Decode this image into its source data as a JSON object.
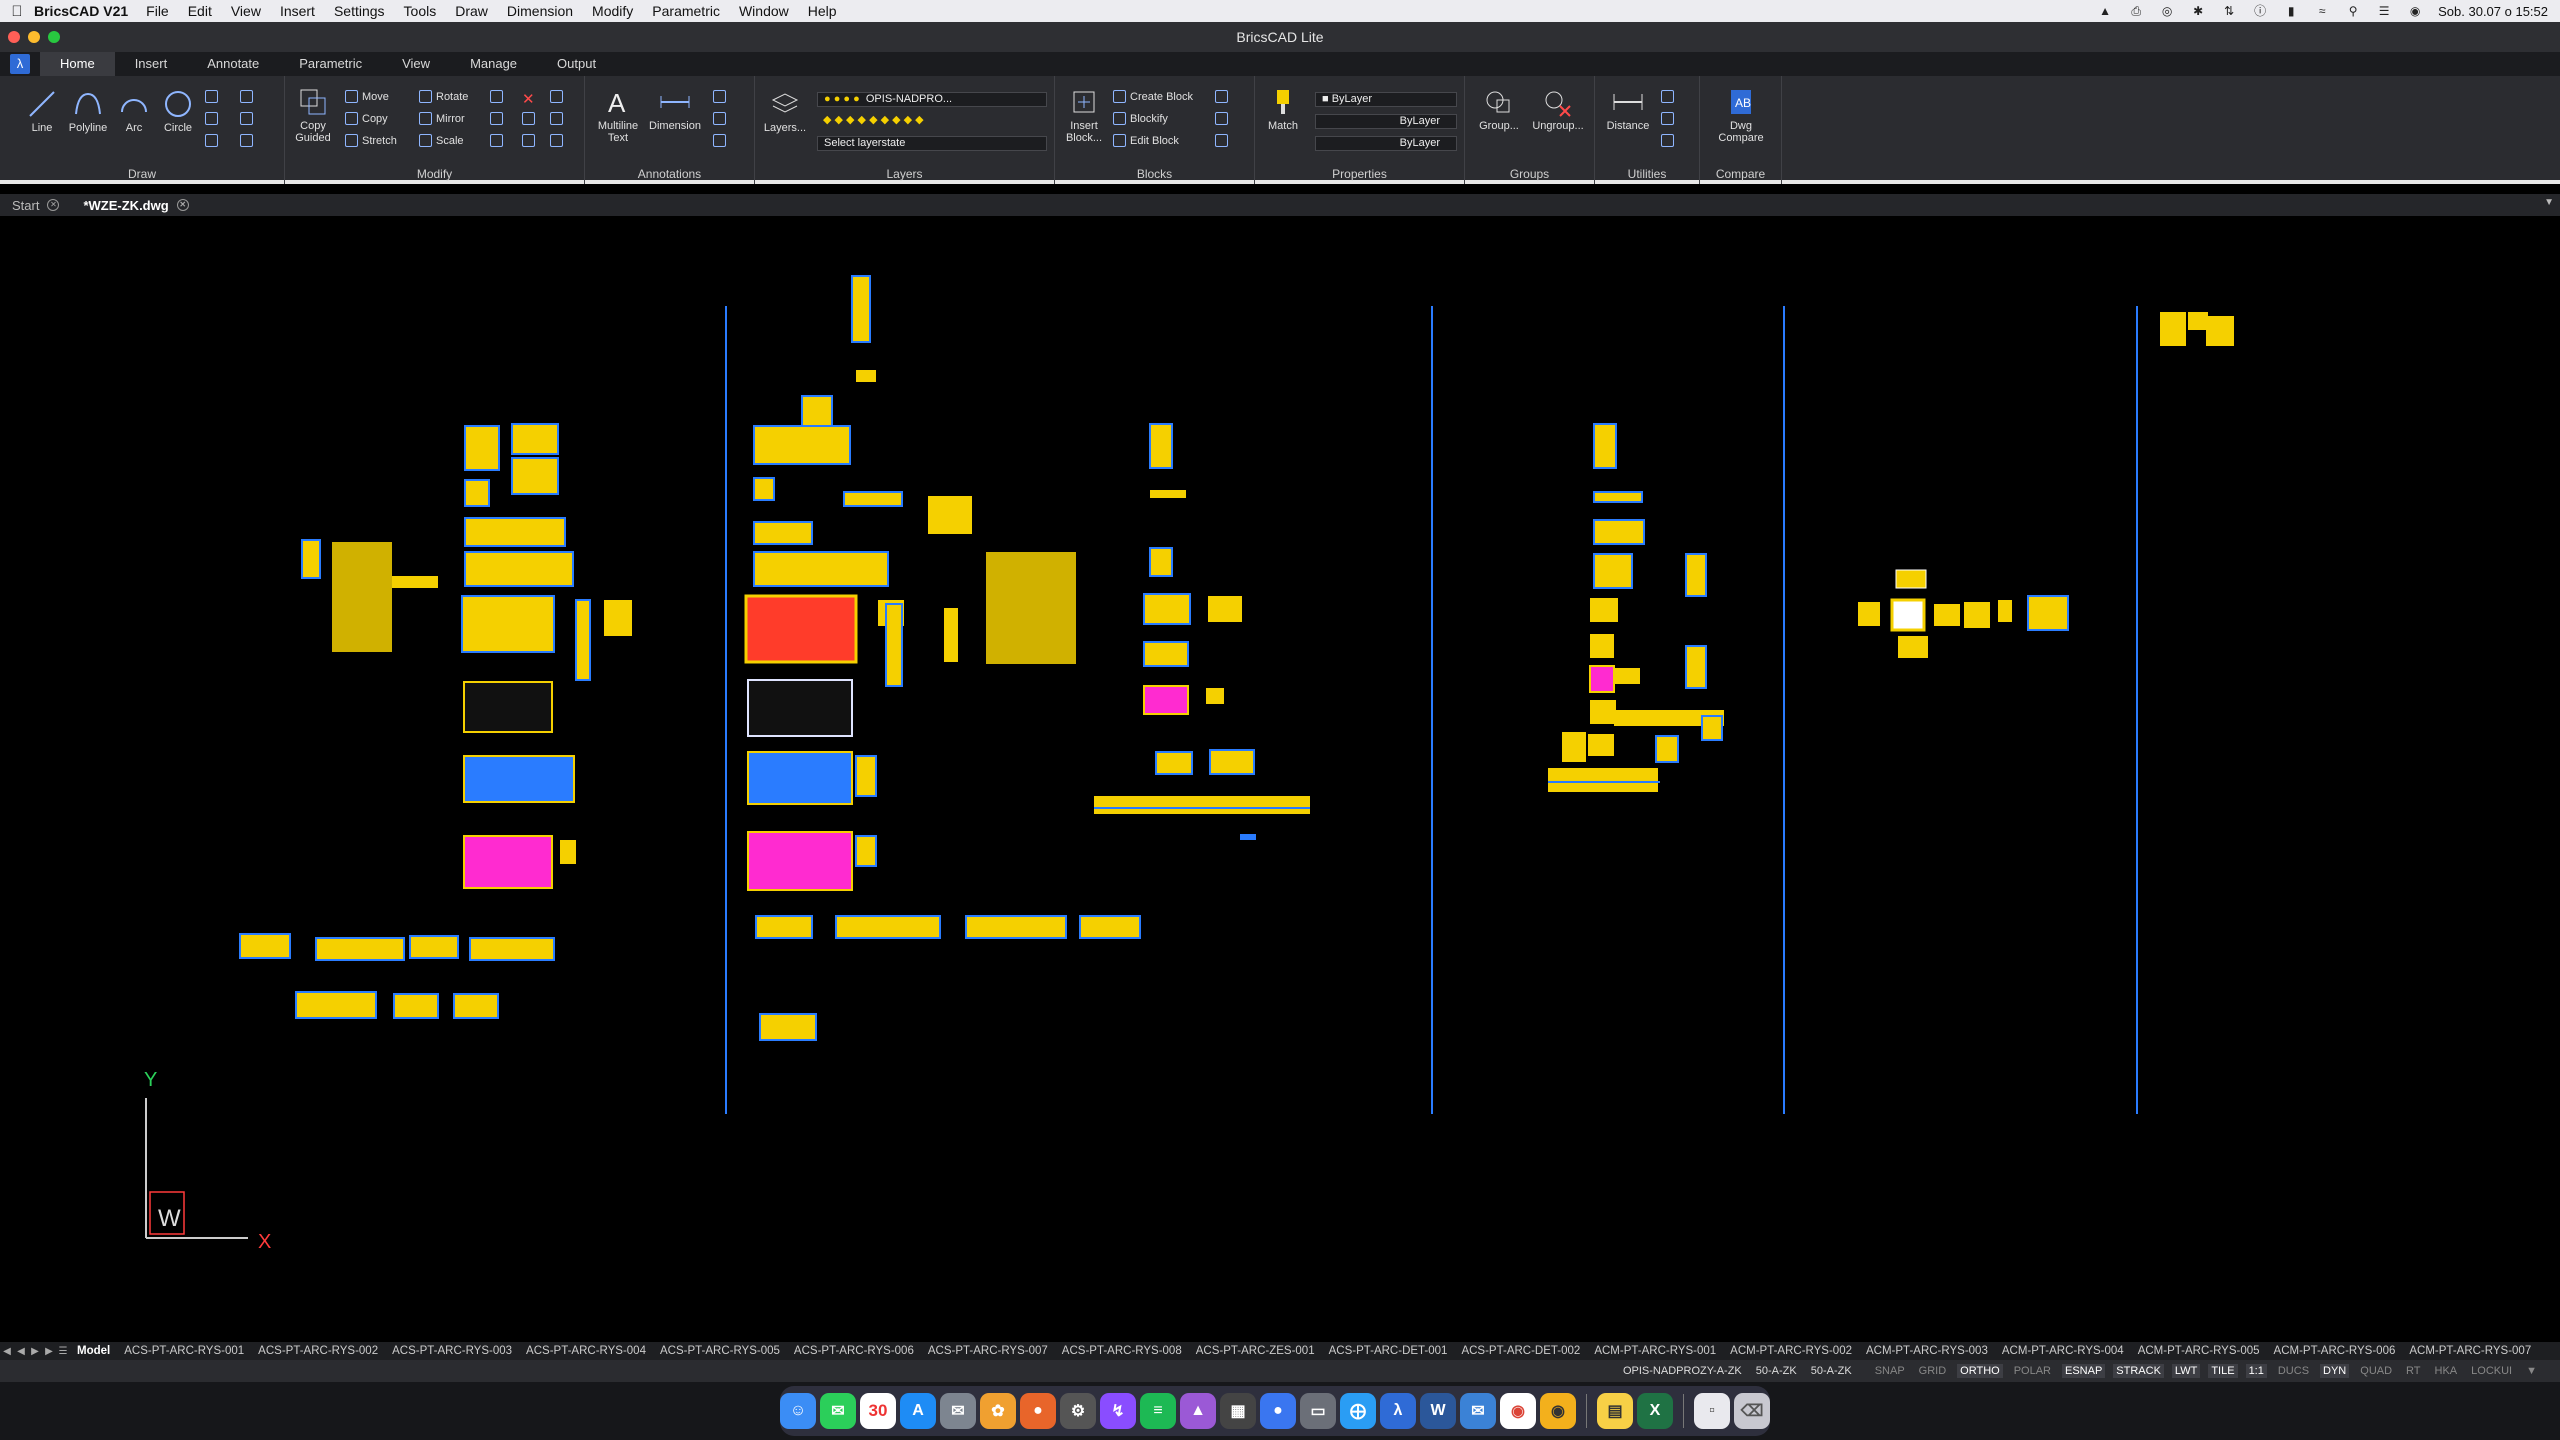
{
  "menubar": {
    "app_name": "BricsCAD V21",
    "items": [
      "File",
      "Edit",
      "View",
      "Insert",
      "Settings",
      "Tools",
      "Draw",
      "Dimension",
      "Modify",
      "Parametric",
      "Window",
      "Help"
    ],
    "clock": "Sob. 30.07 o  15:52"
  },
  "window": {
    "title": "BricsCAD Lite"
  },
  "ribbon": {
    "tabs": [
      "Home",
      "Insert",
      "Annotate",
      "Parametric",
      "View",
      "Manage",
      "Output"
    ],
    "active_tab": "Home",
    "draw": {
      "title": "Draw",
      "line": "Line",
      "polyline": "Polyline",
      "arc": "Arc",
      "circle": "Circle"
    },
    "modify": {
      "title": "Modify",
      "copy_guided": "Copy Guided",
      "move": "Move",
      "copy": "Copy",
      "stretch": "Stretch",
      "rotate": "Rotate",
      "mirror": "Mirror",
      "scale": "Scale"
    },
    "annotations": {
      "title": "Annotations",
      "mtext": "Multiline Text",
      "dimension": "Dimension"
    },
    "layers": {
      "title": "Layers",
      "layers_btn": "Layers...",
      "current_layer": "OPIS-NADPRO...",
      "layerstate": "Select layerstate"
    },
    "blocks": {
      "title": "Blocks",
      "insert": "Insert Block...",
      "create": "Create Block",
      "blockify": "Blockify",
      "edit": "Edit Block"
    },
    "properties": {
      "title": "Properties",
      "match": "Match",
      "color": "ByLayer",
      "linetype": "ByLayer",
      "lineweight": "ByLayer"
    },
    "groups": {
      "title": "Groups",
      "group": "Group...",
      "ungroup": "Ungroup..."
    },
    "utilities": {
      "title": "Utilities",
      "distance": "Distance"
    },
    "compare": {
      "title": "Compare",
      "dwg_compare": "Dwg Compare"
    }
  },
  "doc_tabs": [
    {
      "label": "Start",
      "active": false
    },
    {
      "label": "*WZE-ZK.dwg",
      "active": true
    }
  ],
  "ucs": {
    "y": "Y",
    "x": "X",
    "w": "W"
  },
  "layout_tabs": [
    "Model",
    "ACS-PT-ARC-RYS-001",
    "ACS-PT-ARC-RYS-002",
    "ACS-PT-ARC-RYS-003",
    "ACS-PT-ARC-RYS-004",
    "ACS-PT-ARC-RYS-005",
    "ACS-PT-ARC-RYS-006",
    "ACS-PT-ARC-RYS-007",
    "ACS-PT-ARC-RYS-008",
    "ACS-PT-ARC-ZES-001",
    "ACS-PT-ARC-DET-001",
    "ACS-PT-ARC-DET-002",
    "ACM-PT-ARC-RYS-001",
    "ACM-PT-ARC-RYS-002",
    "ACM-PT-ARC-RYS-003",
    "ACM-PT-ARC-RYS-004",
    "ACM-PT-ARC-RYS-005",
    "ACM-PT-ARC-RYS-006",
    "ACM-PT-ARC-RYS-007"
  ],
  "status": {
    "layer": "OPIS-NADPROZY-A-ZK",
    "dimstyle": "50-A-ZK",
    "textstyle": "50-A-ZK",
    "toggles": [
      {
        "label": "SNAP",
        "on": false
      },
      {
        "label": "GRID",
        "on": false
      },
      {
        "label": "ORTHO",
        "on": true
      },
      {
        "label": "POLAR",
        "on": false
      },
      {
        "label": "ESNAP",
        "on": true
      },
      {
        "label": "STRACK",
        "on": true
      },
      {
        "label": "LWT",
        "on": true
      },
      {
        "label": "TILE",
        "on": true
      },
      {
        "label": "1:1",
        "on": true
      },
      {
        "label": "DUCS",
        "on": false
      },
      {
        "label": "DYN",
        "on": true
      },
      {
        "label": "QUAD",
        "on": false
      },
      {
        "label": "RT",
        "on": false
      },
      {
        "label": "HKA",
        "on": false
      },
      {
        "label": "LOCKUI",
        "on": false
      }
    ]
  },
  "colors": {
    "accent": "#2f6bd6",
    "drawing_yellow": "#f5d000",
    "drawing_blue": "#2a7cff",
    "drawing_magenta": "#ff2bd0"
  },
  "dock": {
    "calendar_day": "30",
    "icons": [
      "finder-icon",
      "messages-icon",
      "calendar-icon",
      "appstore-icon",
      "mail-icon",
      "photos-icon",
      "firefox-icon",
      "settings-icon",
      "messenger-icon",
      "spotify-icon",
      "affinity-icon",
      "calculator-icon",
      "signal-icon",
      "screen-icon",
      "safari-icon",
      "bricscad-icon",
      "word-icon",
      "outlook-icon",
      "chrome-icon",
      "chrome-canary-icon",
      "notes-icon",
      "excel-icon",
      "document-icon",
      "trash-icon"
    ]
  }
}
